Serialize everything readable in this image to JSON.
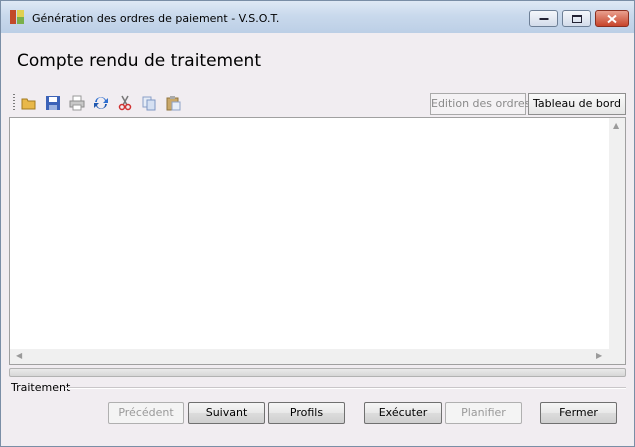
{
  "window": {
    "title": "Génération des ordres de paiement - V.S.O.T."
  },
  "page": {
    "heading": "Compte rendu de traitement"
  },
  "toolbar": {
    "icons": [
      "open-folder-icon",
      "save-icon",
      "print-icon",
      "refresh-icon",
      "cut-icon",
      "copy-icon",
      "paste-icon"
    ]
  },
  "tabs": {
    "edition": "Edition des ordres",
    "tableau": "Tableau de bord"
  },
  "progress": {
    "value_percent": 0
  },
  "group": {
    "label": "Traitement"
  },
  "buttons": {
    "precedent": "Précédent",
    "suivant": "Suivant",
    "profils": "Profils",
    "executer": "Exécuter",
    "planifier": "Planifier",
    "fermer": "Fermer"
  }
}
